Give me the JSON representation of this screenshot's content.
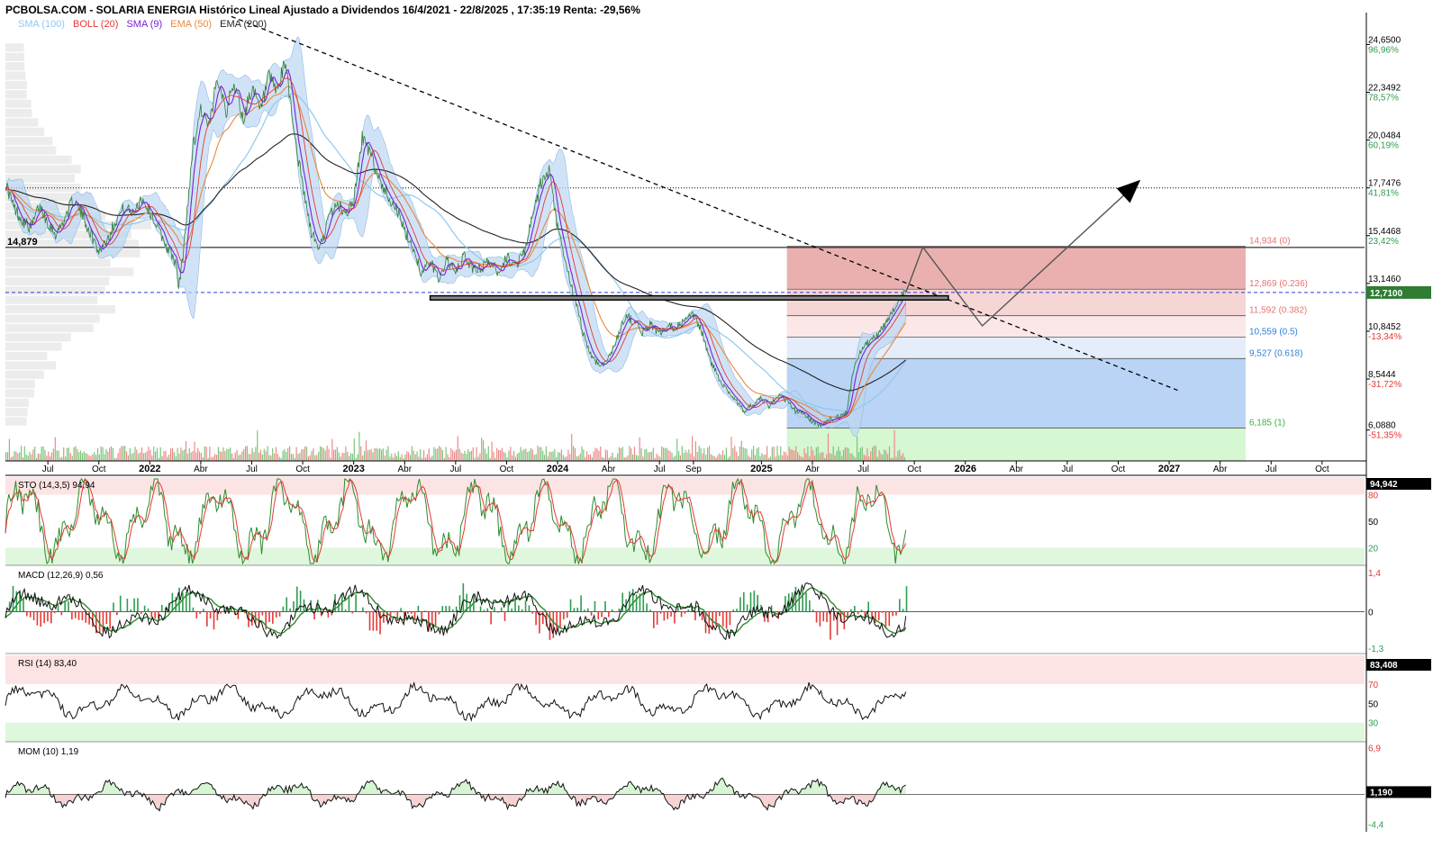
{
  "header": {
    "title": "PCBOLSA.COM - SOLARIA ENERGIA Histórico Lineal Ajustado a Dividendos 16/4/2021 - 22/8/2025 , 17:35:19 Renta: -29,56%"
  },
  "legend": [
    {
      "label": "SMA (100)",
      "color": "#8ec9ee"
    },
    {
      "label": "BOLL (20)",
      "color": "#e53935"
    },
    {
      "label": "SMA (9)",
      "color": "#7b1fd6"
    },
    {
      "label": "EMA (50)",
      "color": "#e8893a"
    },
    {
      "label": "EMA (200)",
      "color": "#222222"
    }
  ],
  "colors": {
    "price": "#2e7d32",
    "boll_band": "#bcd7f2",
    "fib_red": "#e57373",
    "fib_blue": "#5c9ced",
    "fib_green": "#a5e6a0",
    "current_price_box": "#2e7d32",
    "grid": "#cccccc"
  },
  "chart_data": [
    {
      "type": "line",
      "panel": "price",
      "ylim": [
        4.6,
        26.1
      ],
      "y_axis": {
        "ticks": [
          {
            "value": 24.65,
            "label": "24,6500",
            "pct": "96,96%"
          },
          {
            "value": 22.3492,
            "label": "22,3492",
            "pct": "78,57%"
          },
          {
            "value": 20.0484,
            "label": "20,0484",
            "pct": "60,19%"
          },
          {
            "value": 17.7476,
            "label": "17,7476",
            "pct": "41,81%"
          },
          {
            "value": 15.4468,
            "label": "15,4468",
            "pct": "23,42%"
          },
          {
            "value": 13.146,
            "label": "13,1460",
            "pct": ""
          },
          {
            "value": 10.8452,
            "label": "10,8452",
            "pct": "-13,34%"
          },
          {
            "value": 8.5444,
            "label": "8,5444",
            "pct": "-31,72%"
          },
          {
            "value": 6.088,
            "label": "6,0880",
            "pct": "-51,35%"
          }
        ]
      },
      "x_axis": {
        "labels": [
          {
            "t": 2.5,
            "label": "Jul",
            "bold": false
          },
          {
            "t": 5.5,
            "label": "Oct",
            "bold": false
          },
          {
            "t": 8.5,
            "label": "2022",
            "bold": true
          },
          {
            "t": 11.5,
            "label": "Abr",
            "bold": false
          },
          {
            "t": 14.5,
            "label": "Jul",
            "bold": false
          },
          {
            "t": 17.5,
            "label": "Oct",
            "bold": false
          },
          {
            "t": 20.5,
            "label": "2023",
            "bold": true
          },
          {
            "t": 23.5,
            "label": "Abr",
            "bold": false
          },
          {
            "t": 26.5,
            "label": "Jul",
            "bold": false
          },
          {
            "t": 29.5,
            "label": "Oct",
            "bold": false
          },
          {
            "t": 32.5,
            "label": "2024",
            "bold": true
          },
          {
            "t": 35.5,
            "label": "Abr",
            "bold": false
          },
          {
            "t": 38.5,
            "label": "Jul",
            "bold": false
          },
          {
            "t": 40.5,
            "label": "Sep",
            "bold": false
          },
          {
            "t": 44.5,
            "label": "2025",
            "bold": true
          },
          {
            "t": 47.5,
            "label": "Abr",
            "bold": false
          },
          {
            "t": 50.5,
            "label": "Jul",
            "bold": false
          },
          {
            "t": 53.5,
            "label": "Oct",
            "bold": false
          },
          {
            "t": 56.5,
            "label": "2026",
            "bold": true
          },
          {
            "t": 59.5,
            "label": "Abr",
            "bold": false
          },
          {
            "t": 62.5,
            "label": "Jul",
            "bold": false
          },
          {
            "t": 65.5,
            "label": "Oct",
            "bold": false
          },
          {
            "t": 68.5,
            "label": "2027",
            "bold": true
          },
          {
            "t": 71.5,
            "label": "Abr",
            "bold": false
          },
          {
            "t": 74.5,
            "label": "Jul",
            "bold": false
          },
          {
            "t": 77.5,
            "label": "Oct",
            "bold": false
          }
        ]
      },
      "price_points": [
        [
          0,
          18.0
        ],
        [
          0.5,
          16.8
        ],
        [
          1,
          16.2
        ],
        [
          1.5,
          15.8
        ],
        [
          2,
          16.9
        ],
        [
          2.5,
          16.1
        ],
        [
          3,
          15.5
        ],
        [
          3.5,
          16.3
        ],
        [
          4,
          17.2
        ],
        [
          4.5,
          16.5
        ],
        [
          5,
          15.6
        ],
        [
          5.5,
          14.7
        ],
        [
          6,
          15.3
        ],
        [
          6.5,
          16.2
        ],
        [
          7,
          16.8
        ],
        [
          7.5,
          16.5
        ],
        [
          8,
          17.3
        ],
        [
          8.5,
          16.6
        ],
        [
          9,
          15.8
        ],
        [
          9.5,
          14.9
        ],
        [
          10,
          14.2
        ],
        [
          10.2,
          12.9
        ],
        [
          10.5,
          14.8
        ],
        [
          11,
          19.5
        ],
        [
          11.5,
          21.6
        ],
        [
          12,
          20.6
        ],
        [
          12.5,
          23.2
        ],
        [
          13,
          21.5
        ],
        [
          13.5,
          22.8
        ],
        [
          14,
          21.0
        ],
        [
          14.5,
          22.6
        ],
        [
          15,
          21.4
        ],
        [
          15.5,
          23.0
        ],
        [
          16,
          22.4
        ],
        [
          16.5,
          23.8
        ],
        [
          17,
          20.4
        ],
        [
          17.5,
          17.8
        ],
        [
          18,
          15.6
        ],
        [
          18.5,
          14.8
        ],
        [
          19,
          16.2
        ],
        [
          19.5,
          17.0
        ],
        [
          20,
          16.5
        ],
        [
          20.5,
          17.1
        ],
        [
          21,
          20.2
        ],
        [
          21.5,
          19.3
        ],
        [
          22,
          18.2
        ],
        [
          22.5,
          17.4
        ],
        [
          23,
          16.8
        ],
        [
          23.5,
          15.6
        ],
        [
          24,
          14.9
        ],
        [
          24.5,
          13.6
        ],
        [
          25,
          14.2
        ],
        [
          25.5,
          13.4
        ],
        [
          26,
          14.3
        ],
        [
          26.5,
          13.6
        ],
        [
          27,
          14.5
        ],
        [
          27.5,
          13.8
        ],
        [
          28,
          13.9
        ],
        [
          28.5,
          14.2
        ],
        [
          29,
          13.7
        ],
        [
          29.5,
          14.4
        ],
        [
          30,
          14.0
        ],
        [
          30.5,
          14.6
        ],
        [
          31,
          16.2
        ],
        [
          31.5,
          17.9
        ],
        [
          32,
          18.5
        ],
        [
          32.5,
          15.8
        ],
        [
          33,
          14.0
        ],
        [
          33.5,
          12.4
        ],
        [
          34,
          10.8
        ],
        [
          34.5,
          9.6
        ],
        [
          35,
          9.2
        ],
        [
          35.5,
          9.5
        ],
        [
          36,
          10.5
        ],
        [
          36.5,
          11.6
        ],
        [
          37,
          11.3
        ],
        [
          37.5,
          10.8
        ],
        [
          38,
          11.2
        ],
        [
          38.5,
          10.7
        ],
        [
          39,
          11.0
        ],
        [
          39.5,
          11.1
        ],
        [
          40,
          11.3
        ],
        [
          40.5,
          11.6
        ],
        [
          41,
          10.8
        ],
        [
          41.5,
          9.4
        ],
        [
          42,
          8.6
        ],
        [
          42.5,
          8.0
        ],
        [
          43,
          7.5
        ],
        [
          43.5,
          7.0
        ],
        [
          44,
          7.3
        ],
        [
          44.5,
          7.6
        ],
        [
          45,
          7.2
        ],
        [
          45.5,
          7.8
        ],
        [
          46,
          7.5
        ],
        [
          46.5,
          7.0
        ],
        [
          47,
          6.9
        ],
        [
          47.5,
          6.5
        ],
        [
          48,
          6.3
        ],
        [
          48.5,
          6.6
        ],
        [
          49,
          6.7
        ],
        [
          49.5,
          6.9
        ],
        [
          50,
          9.4
        ],
        [
          50.5,
          10.1
        ],
        [
          51,
          10.4
        ],
        [
          51.5,
          10.8
        ],
        [
          52,
          11.5
        ],
        [
          52.5,
          12.3
        ],
        [
          53,
          12.71
        ]
      ],
      "horizontal_levels": [
        {
          "value": 14.879,
          "label": "14,879",
          "style": "solid"
        },
        {
          "value": 12.71,
          "label": "12,7100",
          "style": "dashed-blue"
        },
        {
          "value": 17.7476,
          "label": "",
          "style": "dotted"
        }
      ],
      "fibonacci": [
        {
          "value": 14.934,
          "label": "14,934 (0)"
        },
        {
          "value": 12.869,
          "label": "12,869 (0.236)"
        },
        {
          "value": 11.592,
          "label": "11,592 (0.382)"
        },
        {
          "value": 10.559,
          "label": "10,559 (0.5)"
        },
        {
          "value": 9.527,
          "label": "9,527 (0.618)"
        },
        {
          "value": 6.185,
          "label": "6,185 (1)"
        }
      ],
      "fib_t_range": [
        46.0,
        73.0
      ],
      "trendline": [
        [
          13.3,
          26.0
        ],
        [
          69.0,
          8.0
        ]
      ],
      "support_rect": [
        [
          25.0,
          12.35
        ],
        [
          55.5,
          12.55
        ]
      ],
      "projection": [
        [
          53.0,
          12.71
        ],
        [
          54.0,
          14.9
        ],
        [
          57.5,
          11.1
        ],
        [
          66.5,
          17.9
        ]
      ]
    },
    {
      "type": "line",
      "panel": "STO",
      "title": "STO (14,3,5)",
      "value_label": "94,94",
      "current_box": "94,942",
      "ylim": [
        0,
        100
      ],
      "levels": [
        {
          "value": 80,
          "label": "80"
        },
        {
          "value": 50,
          "label": "50"
        },
        {
          "value": 20,
          "label": "20"
        }
      ]
    },
    {
      "type": "line",
      "panel": "MACD",
      "title": "MACD (12,26,9)",
      "value_label": "0,56",
      "ylim": [
        -1.5,
        1.6
      ],
      "levels": [
        {
          "value": 1.4,
          "label": "1,4"
        },
        {
          "value": 0,
          "label": "0"
        },
        {
          "value": -1.3,
          "label": "-1,3"
        }
      ]
    },
    {
      "type": "line",
      "panel": "RSI",
      "title": "RSI (14)",
      "value_label": "83,40",
      "current_box": "83,408",
      "ylim": [
        10,
        100
      ],
      "levels": [
        {
          "value": 70,
          "label": "70"
        },
        {
          "value": 50,
          "label": "50"
        },
        {
          "value": 30,
          "label": "30"
        }
      ]
    },
    {
      "type": "line",
      "panel": "MOM",
      "title": "MOM (10)",
      "value_label": "1,19",
      "current_box": "1,190",
      "ylim": [
        -5,
        7.5
      ],
      "levels": [
        {
          "value": 6.9,
          "label": "6,9"
        },
        {
          "value": 0,
          "label": "0"
        },
        {
          "value": -4.4,
          "label": "-4,4"
        }
      ]
    }
  ]
}
